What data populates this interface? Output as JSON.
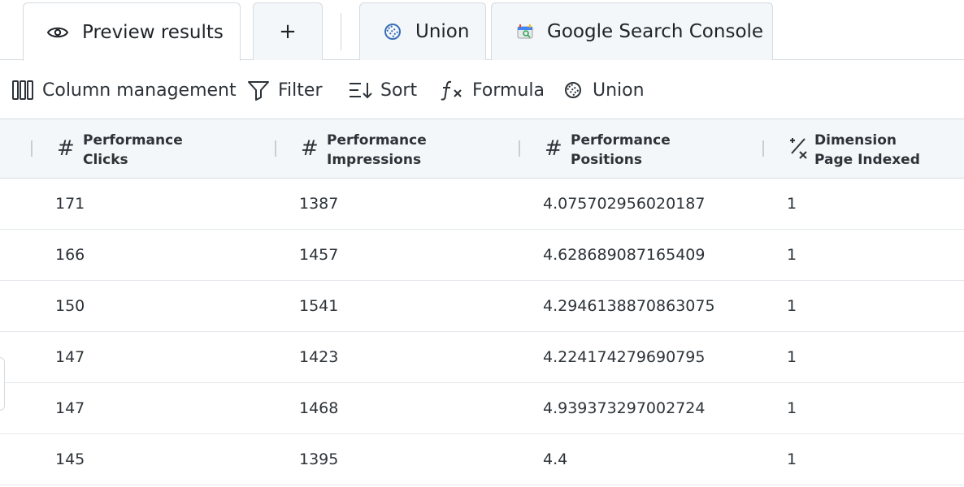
{
  "tabs": {
    "preview": {
      "label": "Preview results",
      "icon": "eye-icon"
    },
    "add": {
      "label": "+"
    },
    "union": {
      "label": "Union",
      "icon": "union-icon"
    },
    "gsc": {
      "label": "Google Search Console",
      "icon": "google-search-console-icon"
    }
  },
  "toolbar": {
    "columns": "Column management",
    "filter": "Filter",
    "sort": "Sort",
    "formula": "Formula",
    "union": "Union"
  },
  "table": {
    "columns": [
      {
        "type_icon": "#",
        "line1": "Performance",
        "line2": "Clicks"
      },
      {
        "type_icon": "#",
        "line1": "Performance",
        "line2": "Impressions"
      },
      {
        "type_icon": "#",
        "line1": "Performance",
        "line2": "Positions"
      },
      {
        "type_icon": "boolean-icon",
        "line1": "Dimension",
        "line2": "Page Indexed"
      }
    ],
    "rows": [
      [
        "171",
        "1387",
        "4.075702956020187",
        "1"
      ],
      [
        "166",
        "1457",
        "4.628689087165409",
        "1"
      ],
      [
        "150",
        "1541",
        "4.2946138870863075",
        "1"
      ],
      [
        "147",
        "1423",
        "4.224174279690795",
        "1"
      ],
      [
        "147",
        "1468",
        "4.939373297002724",
        "1"
      ],
      [
        "145",
        "1395",
        "4.4",
        "1"
      ]
    ]
  },
  "colors": {
    "header_bg": "#f4f7f9",
    "border": "#d5dbe1",
    "text": "#2d3338",
    "union_icon": "#3b6fb6"
  }
}
